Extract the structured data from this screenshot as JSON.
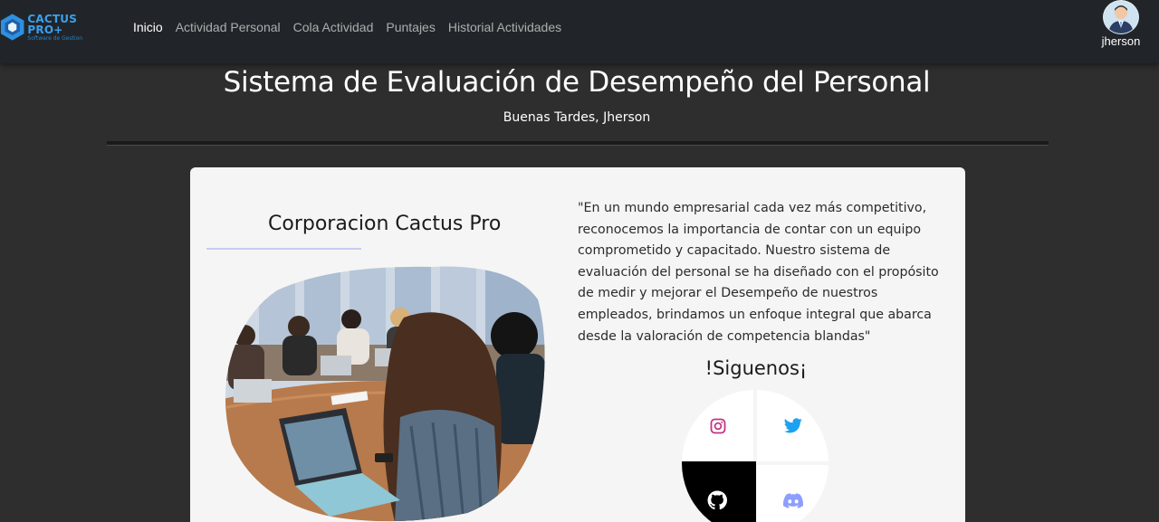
{
  "nav": {
    "brand_name": "CACTUS PRO+",
    "brand_sub": "Software de Gestion",
    "links": [
      {
        "label": "Inicio",
        "active": true
      },
      {
        "label": "Actividad Personal",
        "active": false
      },
      {
        "label": "Cola Actividad",
        "active": false
      },
      {
        "label": "Puntajes",
        "active": false
      },
      {
        "label": "Historial Actividades",
        "active": false
      }
    ],
    "username": "jherson",
    "avatar_icon": "user-avatar-icon"
  },
  "header": {
    "title": "Sistema de Evaluación de Desempeño del Personal",
    "greeting": "Buenas Tardes, Jherson"
  },
  "card": {
    "company_title": "Corporacion Cactus Pro",
    "quote": "\"En un mundo empresarial cada vez más competitivo, reconocemos la importancia de contar con un equipo comprometido y capacitado. Nuestro sistema de evaluación del personal se ha diseñado con el propósito de medir y mejorar el Desempeño de nuestros empleados, brindamos un enfoque integral que abarca desde la valoración de competencia blandas\"",
    "follow_title": "!Siguenos¡",
    "social": [
      {
        "name": "instagram",
        "icon": "instagram-icon",
        "color": "#c13584"
      },
      {
        "name": "twitter",
        "icon": "twitter-icon",
        "color": "#1da1f2"
      },
      {
        "name": "github",
        "icon": "github-icon",
        "color": "#ffffff"
      },
      {
        "name": "discord",
        "icon": "discord-icon",
        "color": "#8c9eff"
      }
    ]
  },
  "colors": {
    "navbar_bg": "#212529",
    "page_bg": "#2e2e2e",
    "card_bg": "#f5f5f5",
    "brand_blue": "#3aa0ee"
  }
}
